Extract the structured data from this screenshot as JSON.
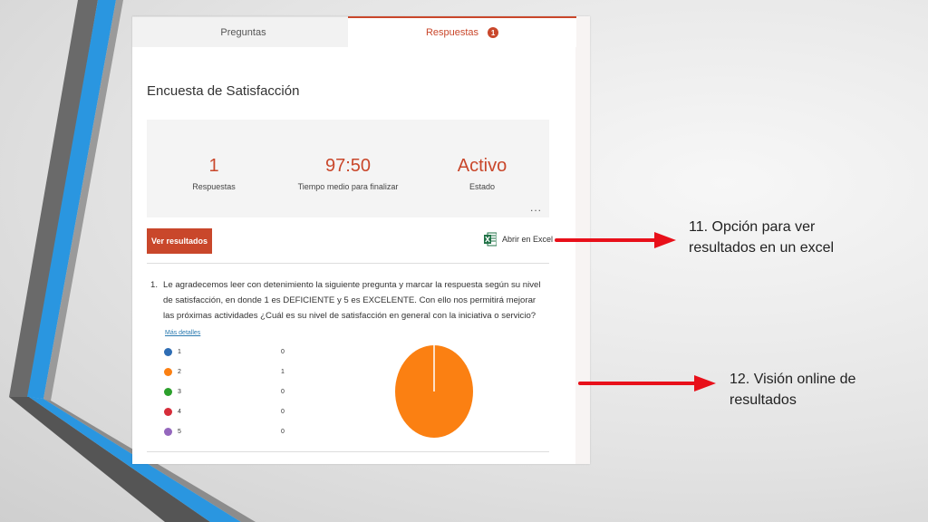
{
  "tabs": [
    {
      "label": "Preguntas",
      "active": false
    },
    {
      "label": "Respuestas",
      "active": true,
      "badge": "1"
    }
  ],
  "form_title": "Encuesta de Satisfacción",
  "stats": [
    {
      "value": "1",
      "label": "Respuestas"
    },
    {
      "value": "97:50",
      "label": "Tiempo medio para finalizar"
    },
    {
      "value": "Activo",
      "label": "Estado"
    }
  ],
  "more_label": "...",
  "buttons": {
    "ver_resultados": "Ver resultados",
    "abrir_excel": "Abrir en Excel"
  },
  "question": {
    "number": "1.",
    "text": "Le agradecemos leer con detenimiento la siguiente pregunta y marcar la respuesta según su nivel de satisfacción, en donde 1 es DEFICIENTE y 5 es EXCELENTE. Con ello nos permitirá mejorar las próximas actividades ¿Cuál es su nivel de satisfacción en general con la iniciativa o servicio?",
    "details_link": "Más detalles",
    "options": [
      {
        "label": "1",
        "count": "0",
        "color": "#2e6db4"
      },
      {
        "label": "2",
        "count": "1",
        "color": "#fb8012"
      },
      {
        "label": "3",
        "count": "0",
        "color": "#2ca02c"
      },
      {
        "label": "4",
        "count": "0",
        "color": "#d62d3a"
      },
      {
        "label": "5",
        "count": "0",
        "color": "#9467bd"
      }
    ]
  },
  "chart_data": {
    "type": "pie",
    "categories": [
      "1",
      "2",
      "3",
      "4",
      "5"
    ],
    "values": [
      0,
      1,
      0,
      0,
      0
    ],
    "colors": [
      "#2e6db4",
      "#fb8012",
      "#2ca02c",
      "#d62d3a",
      "#9467bd"
    ]
  },
  "annotations": [
    {
      "line1": "11. Opción para ver",
      "line2": "resultados en un excel"
    },
    {
      "line1": "12. Visión online de",
      "line2": "resultados"
    }
  ],
  "colors": {
    "accent": "#c9472b",
    "arrow": "#e8101a",
    "stripe_blue": "#2a96e0",
    "stripe_gray": "#5a5a5a"
  }
}
